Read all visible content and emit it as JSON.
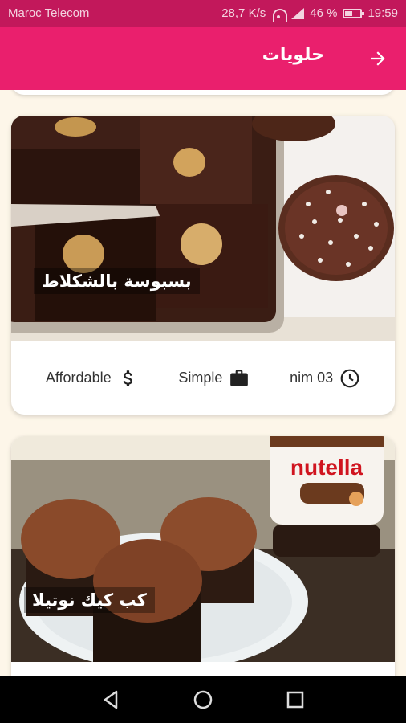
{
  "status_bar": {
    "carrier": "Maroc Telecom",
    "speed": "28,7 K/s",
    "battery": "46 %",
    "time": "19:59"
  },
  "app_bar": {
    "title": "حلويات",
    "back_icon": "arrow-right-icon"
  },
  "recipes": [
    {
      "title": "بسبوسة بالشكلاط",
      "affordability": "Affordable",
      "complexity": "Simple",
      "duration": "30 min"
    },
    {
      "title": "كب كيك نوتيلا",
      "image_label": "nutella"
    }
  ],
  "nav_bar": {
    "icons": [
      "back-triangle-icon",
      "home-circle-icon",
      "recents-square-icon"
    ]
  },
  "colors": {
    "status_bar": "#c2185b",
    "app_bar": "#ea1f6d",
    "background": "#fdf6e9"
  }
}
